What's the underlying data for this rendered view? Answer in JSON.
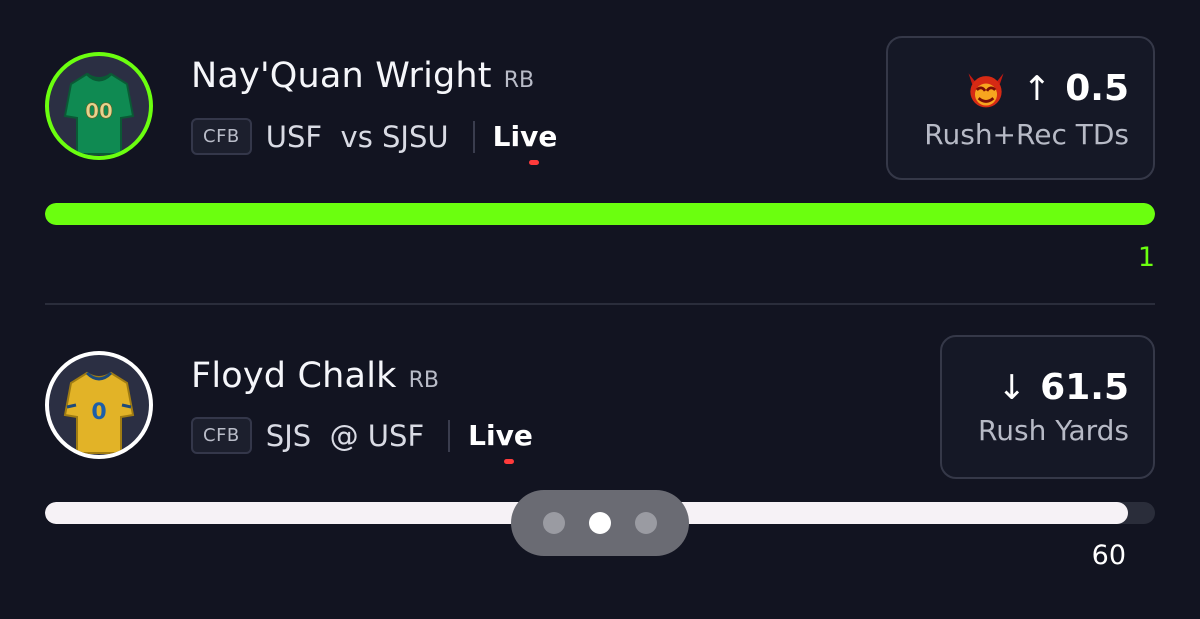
{
  "players": [
    {
      "name": "Nay'Quan Wright",
      "position": "RB",
      "league": "CFB",
      "matchup": "USF  vs SJSU",
      "status": "Live",
      "pick": {
        "direction": "up",
        "arrow": "↑",
        "line": "0.5",
        "stat": "Rush+Rec TDs",
        "icon": "demon-icon"
      },
      "progress": {
        "value": "1",
        "fraction": 1.0,
        "color": "#6bff0f"
      },
      "jersey": {
        "number": "00",
        "color": "#0f8a52",
        "ring": "#6bff0f"
      }
    },
    {
      "name": "Floyd Chalk",
      "position": "RB",
      "league": "CFB",
      "matchup": "SJS  @ USF",
      "status": "Live",
      "pick": {
        "direction": "down",
        "arrow": "↓",
        "line": "61.5",
        "stat": "Rush Yards"
      },
      "progress": {
        "value": "60",
        "fraction": 0.976,
        "color": "#f6f2f6"
      },
      "jersey": {
        "number": "0",
        "color": "#e2b327",
        "ring": "#ffffff"
      }
    }
  ],
  "pager": {
    "count": 3,
    "active_index": 1
  }
}
